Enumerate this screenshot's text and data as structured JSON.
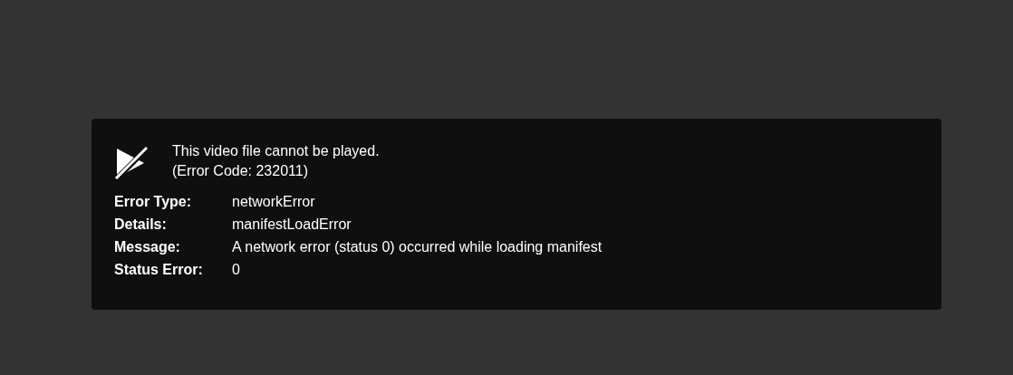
{
  "error_dialog": {
    "message_lines": [
      "This video file cannot be played.",
      "(Error Code: 232011)"
    ],
    "details": [
      {
        "label": "Error Type:",
        "value": "networkError"
      },
      {
        "label": "Details:",
        "value": "manifestLoadError"
      },
      {
        "label": "Message:",
        "value": "A network error (status 0) occurred while loading manifest"
      },
      {
        "label": "Status Error:",
        "value": "0"
      }
    ]
  }
}
